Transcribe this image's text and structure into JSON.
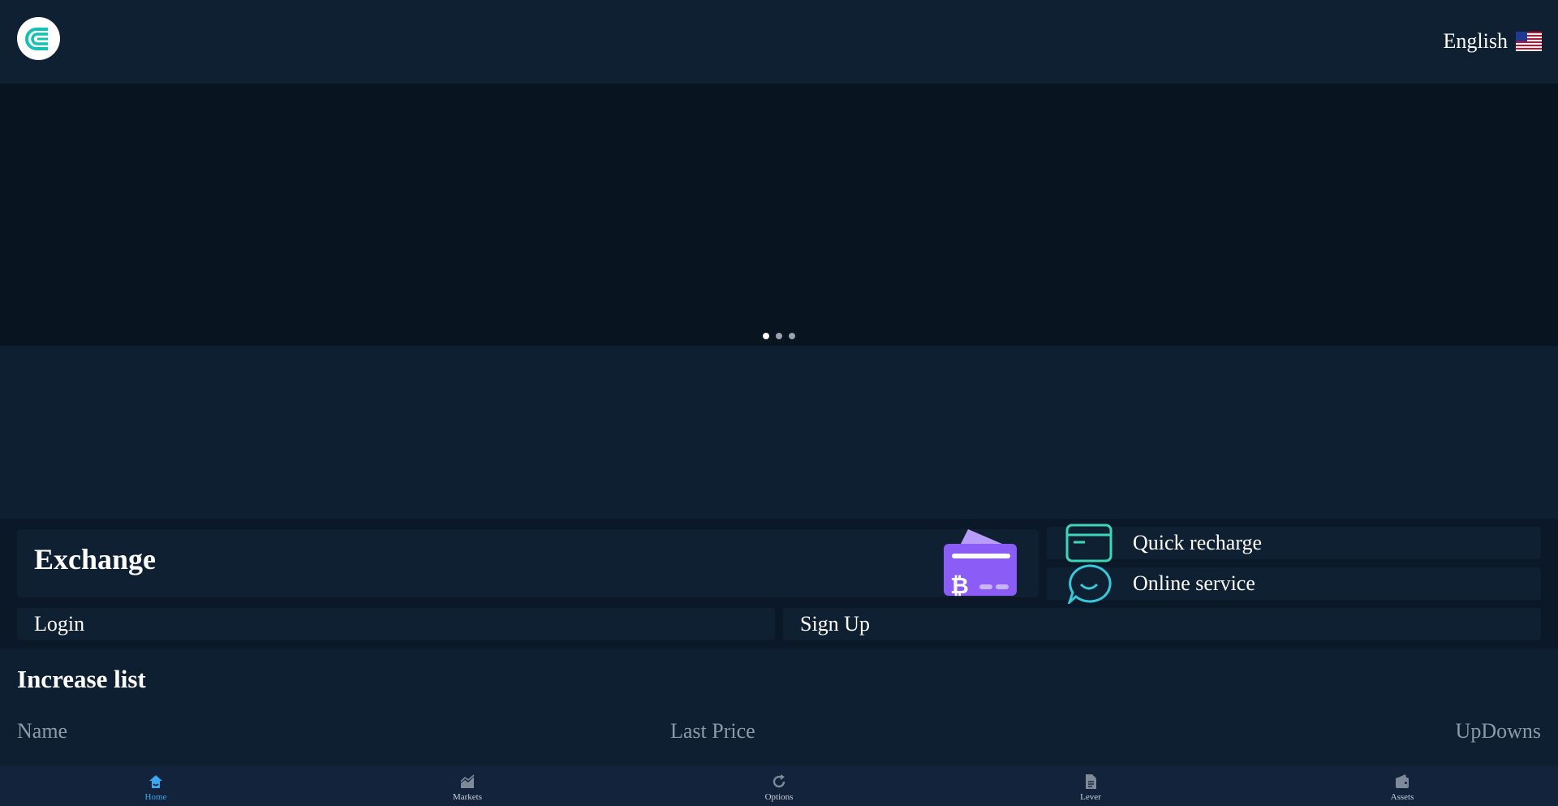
{
  "header": {
    "language_label": "English",
    "flag_icon": "us-flag-icon"
  },
  "banner": {
    "slide_count": 3,
    "active_slide": 1
  },
  "actions": {
    "exchange_label": "Exchange",
    "quick_recharge_label": "Quick recharge",
    "online_service_label": "Online service",
    "login_label": "Login",
    "signup_label": "Sign Up"
  },
  "increase_list": {
    "title": "Increase list",
    "columns": [
      "Name",
      "Last Price",
      "UpDowns"
    ]
  },
  "bottom_nav": {
    "items": [
      {
        "label": "Home",
        "icon": "home-icon",
        "active": true
      },
      {
        "label": "Markets",
        "icon": "chart-icon",
        "active": false
      },
      {
        "label": "Options",
        "icon": "refresh-icon",
        "active": false
      },
      {
        "label": "Lever",
        "icon": "document-icon",
        "active": false
      },
      {
        "label": "Assets",
        "icon": "wallet-icon",
        "active": false
      }
    ]
  },
  "colors": {
    "accent": "#3ba7f0",
    "logo_teal": "#13c2b0",
    "card_purple": "#8b5cf6"
  }
}
